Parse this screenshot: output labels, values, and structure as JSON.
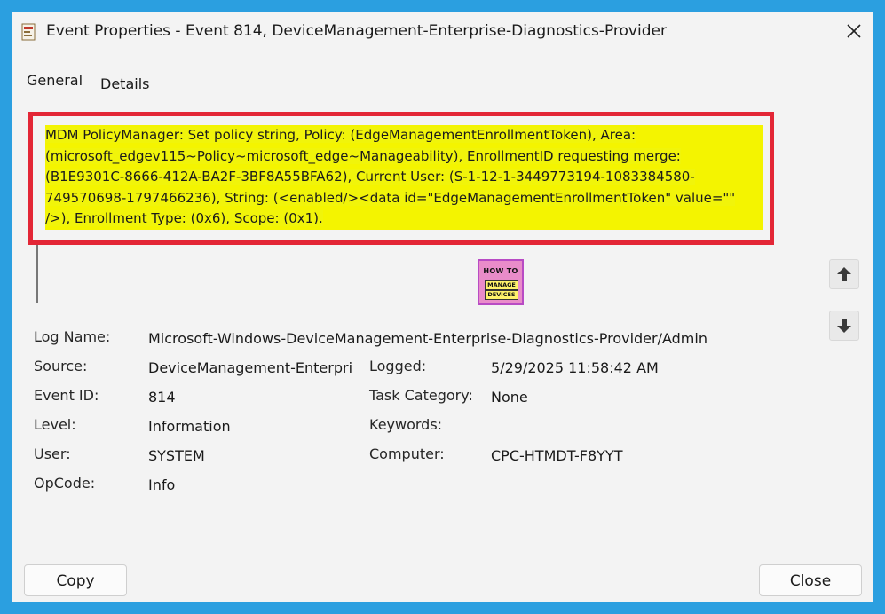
{
  "window": {
    "title": "Event Properties - Event 814, DeviceManagement-Enterprise-Diagnostics-Provider"
  },
  "tabs": [
    {
      "label": "General"
    },
    {
      "label": "Details"
    }
  ],
  "message": {
    "text": "MDM PolicyManager: Set policy string, Policy: (EdgeManagementEnrollmentToken), Area: (microsoft_edgev115~Policy~microsoft_edge~Manageability), EnrollmentID requesting merge: (B1E9301C-8666-412A-BA2F-3BF8A55BFA62), Current User: (S-1-12-1-3449773194-1083384580-749570698-1797466236), String: (<enabled/><data id=\"EdgeManagementEnrollmentToken\" value=\"\" />), Enrollment Type: (0x6), Scope: (0x1).",
    "highlight_color": "#f1f40a",
    "box_color": "#e32636"
  },
  "logo": {
    "line1": "HOW TO",
    "line2": "MANAGE",
    "line3": "DEVICES"
  },
  "fields": {
    "log_name": {
      "label": "Log Name:",
      "value": "Microsoft-Windows-DeviceManagement-Enterprise-Diagnostics-Provider/Admin"
    },
    "source": {
      "label": "Source:",
      "value": "DeviceManagement-Enterpri"
    },
    "logged": {
      "label": "Logged:",
      "value": "5/29/2025 11:58:42 AM"
    },
    "event_id": {
      "label": "Event ID:",
      "value": "814"
    },
    "task_category": {
      "label": "Task Category:",
      "value": "None"
    },
    "level": {
      "label": "Level:",
      "value": "Information"
    },
    "keywords": {
      "label": "Keywords:",
      "value": ""
    },
    "user": {
      "label": "User:",
      "value": "SYSTEM"
    },
    "computer": {
      "label": "Computer:",
      "value": "CPC-HTMDT-F8YYT"
    },
    "opcode": {
      "label": "OpCode:",
      "value": "Info"
    }
  },
  "buttons": {
    "copy": "Copy",
    "close": "Close"
  },
  "colors": {
    "background": "#2b9fe0",
    "window": "#f3f3f3"
  }
}
